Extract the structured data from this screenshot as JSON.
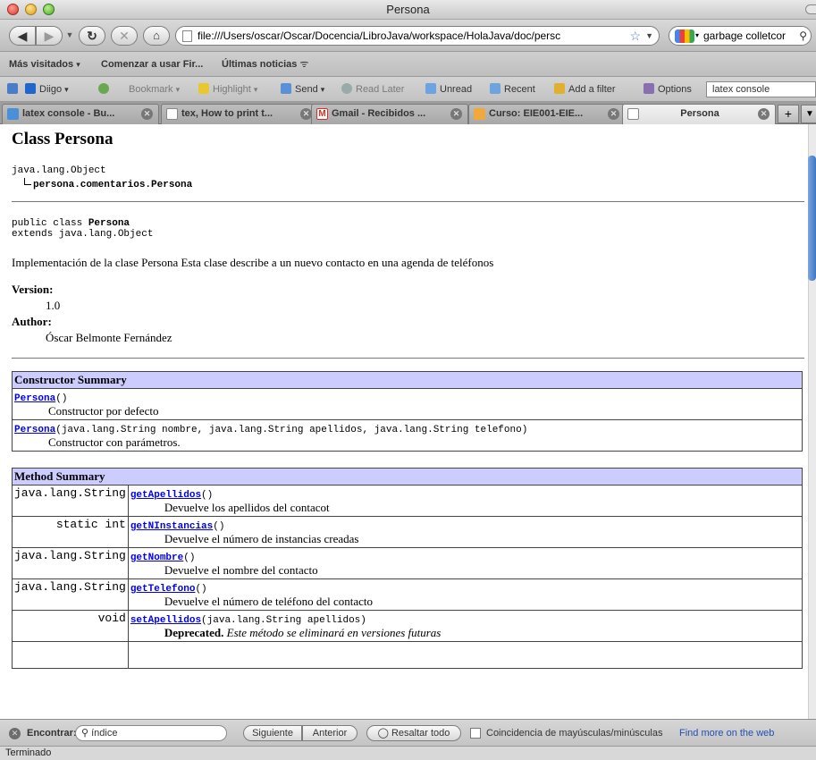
{
  "window": {
    "title": "Persona"
  },
  "nav": {
    "url": "file:///Users/oscar/Oscar/Docencia/LibroJava/workspace/HolaJava/doc/persc",
    "search_value": "garbage colletcor"
  },
  "bookmarks": {
    "items": [
      "Más visitados",
      "Comenzar a usar Fir...",
      "Últimas noticias"
    ]
  },
  "diigo": {
    "brand": "Diigo",
    "bookmark": "Bookmark",
    "highlight": "Highlight",
    "send": "Send",
    "read_later": "Read Later",
    "unread": "Unread",
    "recent": "Recent",
    "add_filter": "Add a filter",
    "options": "Options",
    "search_value": "latex console"
  },
  "tabs": [
    {
      "label": "latex console - Bu...",
      "color": "#4a8fd8"
    },
    {
      "label": "tex, How to print t...",
      "color": "#ffffff"
    },
    {
      "label": "Gmail - Recibidos ...",
      "color": "#d93025"
    },
    {
      "label": "Curso: EIE001-EIE...",
      "color": "#f2a93b"
    },
    {
      "label": "Persona",
      "color": "#ffffff"
    }
  ],
  "doc": {
    "class_title": "Class Persona",
    "hierarchy_parent": "java.lang.Object",
    "hierarchy_child": "persona.comentarios.Persona",
    "decl_prefix": "public class ",
    "decl_name": "Persona",
    "decl_extends": "extends java.lang.Object",
    "description": "Implementación de la clase Persona Esta clase describe a un nuevo contacto en una agenda de teléfonos",
    "version_label": "Version:",
    "version_value": "1.0",
    "author_label": "Author:",
    "author_value": "Óscar Belmonte Fernández"
  },
  "constructor_summary": {
    "title": "Constructor Summary",
    "rows": [
      {
        "name": "Persona",
        "sig": "()",
        "desc": "Constructor por defecto"
      },
      {
        "name": "Persona",
        "sig": "(java.lang.String nombre, java.lang.String apellidos, java.lang.String telefono)",
        "desc": "Constructor con parámetros."
      }
    ]
  },
  "method_summary": {
    "title": "Method Summary",
    "rows": [
      {
        "type": "java.lang.String",
        "name": "getApellidos",
        "sig": "()",
        "desc": "Devuelve los apellidos del contacot",
        "deprecated": ""
      },
      {
        "type": "static int",
        "name": "getNInstancias",
        "sig": "()",
        "desc": "Devuelve el número de instancias creadas",
        "deprecated": ""
      },
      {
        "type": "java.lang.String",
        "name": "getNombre",
        "sig": "()",
        "desc": "Devuelve el nombre del contacto",
        "deprecated": ""
      },
      {
        "type": "java.lang.String",
        "name": "getTelefono",
        "sig": "()",
        "desc": "Devuelve el número de teléfono del contacto",
        "deprecated": ""
      },
      {
        "type": "void",
        "name": "setApellidos",
        "sig": "(java.lang.String apellidos)",
        "desc": "Este método se eliminará en versiones futuras",
        "deprecated": "Deprecated."
      }
    ]
  },
  "findbar": {
    "label": "Encontrar:",
    "value": "índice",
    "next": "Siguiente",
    "prev": "Anterior",
    "highlight_all": "Resaltar todo",
    "match_case": "Coincidencia de mayúsculas/minúsculas",
    "find_more": "Find more on the web"
  },
  "status": {
    "text": "Terminado"
  }
}
